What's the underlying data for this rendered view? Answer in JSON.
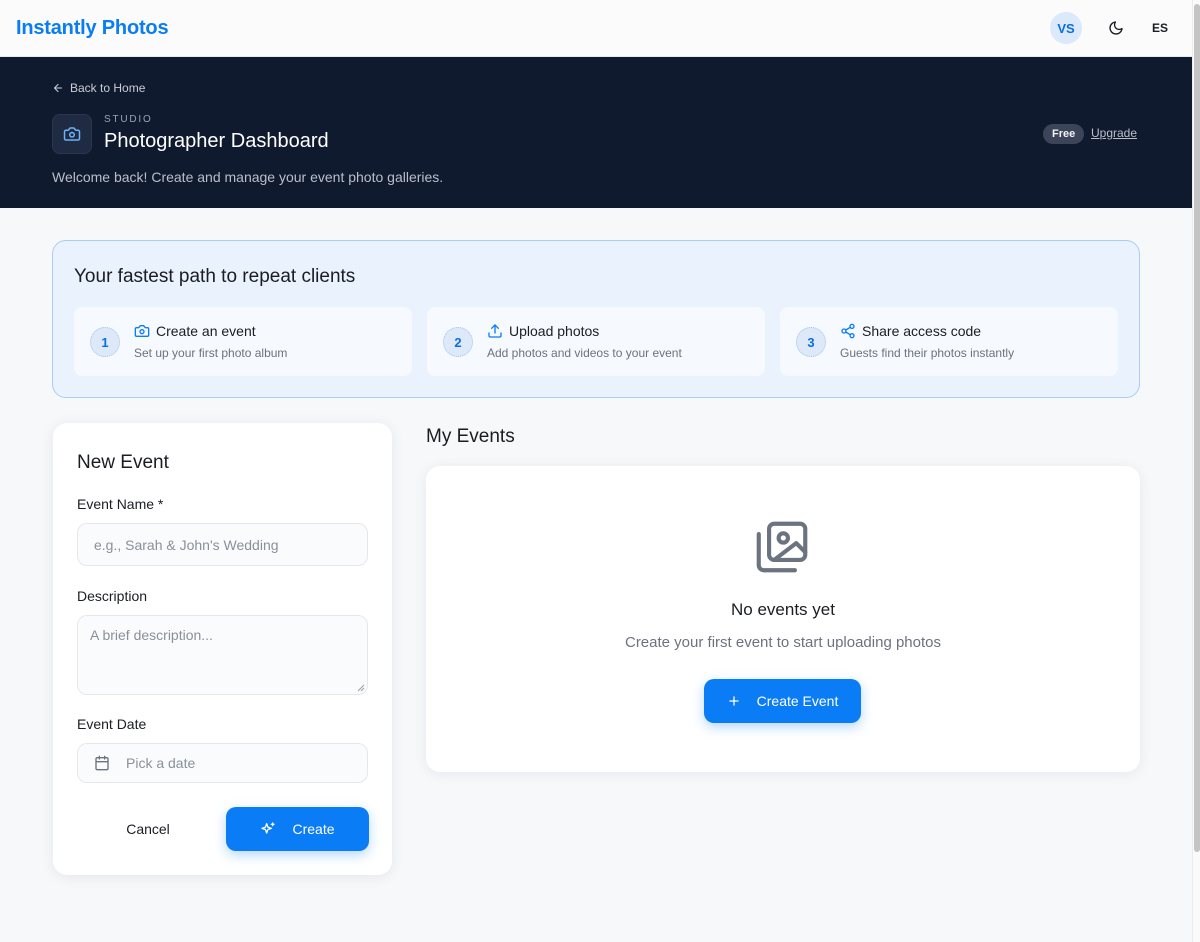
{
  "nav": {
    "brand": "Instantly Photos",
    "avatar_initials": "VS",
    "theme_icon": "moon-icon",
    "language": "ES"
  },
  "hero": {
    "back_label": "Back to Home",
    "eyebrow": "STUDIO",
    "title": "Photographer Dashboard",
    "subtitle": "Welcome back! Create and manage your event photo galleries.",
    "plan_badge": "Free",
    "upgrade_label": "Upgrade"
  },
  "onboarding": {
    "title": "Your fastest path to repeat clients",
    "steps": [
      {
        "number": "1",
        "icon": "camera-icon",
        "title": "Create an event",
        "description": "Set up your first photo album"
      },
      {
        "number": "2",
        "icon": "upload-icon",
        "title": "Upload photos",
        "description": "Add photos and videos to your event"
      },
      {
        "number": "3",
        "icon": "share-icon",
        "title": "Share access code",
        "description": "Guests find their photos instantly"
      }
    ]
  },
  "new_event": {
    "title": "New Event",
    "name_label": "Event Name *",
    "name_placeholder": "e.g., Sarah & John's Wedding",
    "name_value": "",
    "description_label": "Description",
    "description_placeholder": "A brief description...",
    "description_value": "",
    "date_label": "Event Date",
    "date_placeholder": "Pick a date",
    "cancel_label": "Cancel",
    "create_label": "Create"
  },
  "my_events": {
    "title": "My Events",
    "empty_title": "No events yet",
    "empty_subtitle": "Create your first event to start uploading photos",
    "create_label": "Create Event"
  },
  "colors": {
    "accent": "#0a7cf5",
    "hero_bg": "#101a2e",
    "onboarding_bg": "#e9f2fd",
    "page_bg": "#f7f8fa"
  }
}
